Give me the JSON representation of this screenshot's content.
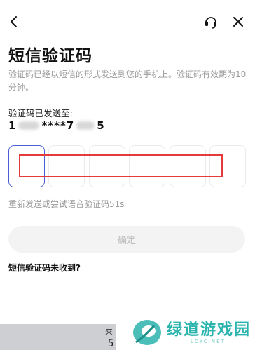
{
  "header": {
    "back_icon": "chevron-left-icon",
    "support_icon": "headset-icon",
    "close_icon": "close-icon"
  },
  "title": "短信验证码",
  "description": "验证码已经以短信的形式发送到您的手机上。验证码有效期为10分钟。",
  "sent_to": {
    "label": "验证码已发送至:",
    "phone_prefix": "1",
    "phone_mask": "****7",
    "phone_suffix": "5"
  },
  "code_inputs": [
    "",
    "",
    "",
    "",
    "",
    ""
  ],
  "resend": "重新发送或尝试语音验证码51s",
  "confirm_label": "确定",
  "not_received": "短信验证码未收到?",
  "keyboard": {
    "top_char": "来",
    "bottom_char": "5"
  },
  "watermark": {
    "text": "绿道游戏园",
    "sub": "LDYC.NET"
  },
  "colors": {
    "active_border": "#4a5fd6",
    "overlay_red": "#e53a3a",
    "watermark": "#2bb3ad"
  }
}
